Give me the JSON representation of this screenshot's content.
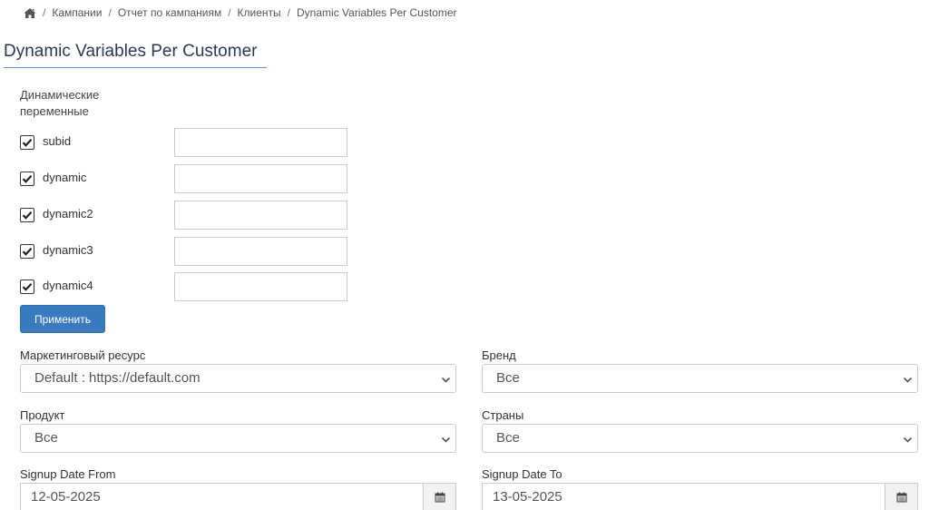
{
  "breadcrumb": {
    "items": [
      "Кампании",
      "Отчет по кампаниям",
      "Клиенты",
      "Dynamic Variables Per Customer"
    ],
    "separator": "/"
  },
  "page": {
    "title": "Dynamic Variables Per Customer"
  },
  "dynamic_vars": {
    "label_line1": "Динамические",
    "label_line2": "переменные",
    "items": [
      {
        "name": "subid",
        "checked": true,
        "value": ""
      },
      {
        "name": "dynamic",
        "checked": true,
        "value": ""
      },
      {
        "name": "dynamic2",
        "checked": true,
        "value": ""
      },
      {
        "name": "dynamic3",
        "checked": true,
        "value": ""
      },
      {
        "name": "dynamic4",
        "checked": true,
        "value": ""
      }
    ],
    "apply_label": "Применить"
  },
  "filters": {
    "marketing_resource": {
      "label": "Маркетинговый ресурс",
      "value": "Default : https://default.com"
    },
    "brand": {
      "label": "Бренд",
      "value": "Все"
    },
    "product": {
      "label": "Продукт",
      "value": "Все"
    },
    "countries": {
      "label": "Страны",
      "value": "Все"
    },
    "signup_from": {
      "label": "Signup Date From",
      "value": "12-05-2025"
    },
    "signup_to": {
      "label": "Signup Date To",
      "value": "13-05-2025"
    }
  },
  "colors": {
    "primary_button": "#3a7bc0",
    "title_underline": "#5b9bd5",
    "border": "#cccccc"
  },
  "icons": {
    "home": "home-icon",
    "check": "check-icon",
    "chevron": "chevron-down-icon",
    "calendar": "calendar-icon"
  }
}
